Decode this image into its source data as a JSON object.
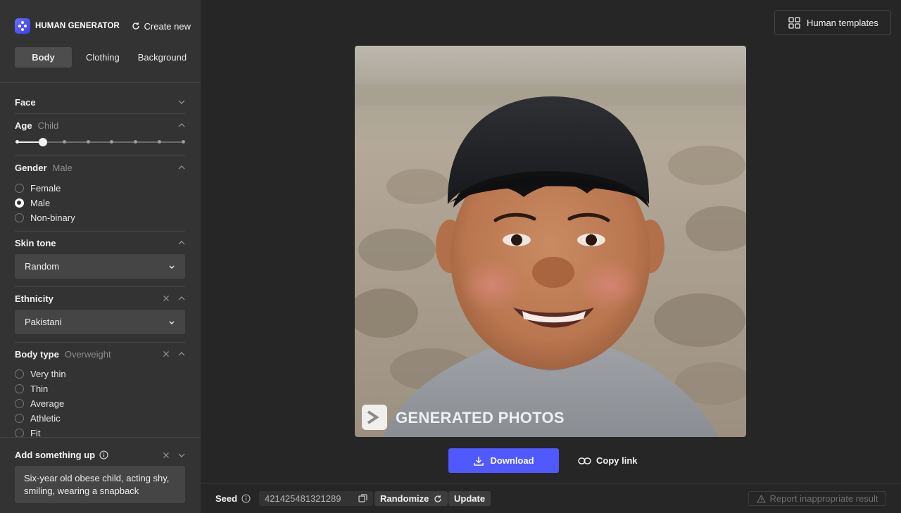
{
  "brand": {
    "name": "HUMAN GENERATOR",
    "create_new": "Create new"
  },
  "tabs": [
    {
      "label": "Body",
      "active": true
    },
    {
      "label": "Clothing",
      "active": false
    },
    {
      "label": "Background",
      "active": false
    }
  ],
  "sections": {
    "face": {
      "title": "Face"
    },
    "age": {
      "title": "Age",
      "value": "Child",
      "slider_steps": 8,
      "slider_index": 1
    },
    "gender": {
      "title": "Gender",
      "value": "Male",
      "options": [
        "Female",
        "Male",
        "Non-binary"
      ],
      "selected": "Male"
    },
    "skin_tone": {
      "title": "Skin tone",
      "value": "Random"
    },
    "ethnicity": {
      "title": "Ethnicity",
      "value": "Pakistani"
    },
    "body_type": {
      "title": "Body type",
      "value": "Overweight",
      "options": [
        "Very thin",
        "Thin",
        "Average",
        "Athletic",
        "Fit"
      ]
    }
  },
  "add_something": {
    "title": "Add something up",
    "prompt": "Six-year old obese child, acting shy, smiling, wearing a snapback"
  },
  "main": {
    "templates_button": "Human templates",
    "watermark": "GENERATED PHOTOS",
    "download": "Download",
    "copy_link": "Copy link"
  },
  "bottom": {
    "seed_label": "Seed",
    "seed_value": "421425481321289",
    "randomize": "Randomize",
    "update": "Update",
    "report": "Report inappropriate result"
  },
  "colors": {
    "accent": "#5058ff",
    "sidebar_bg": "#333333",
    "page_bg": "#262626"
  }
}
